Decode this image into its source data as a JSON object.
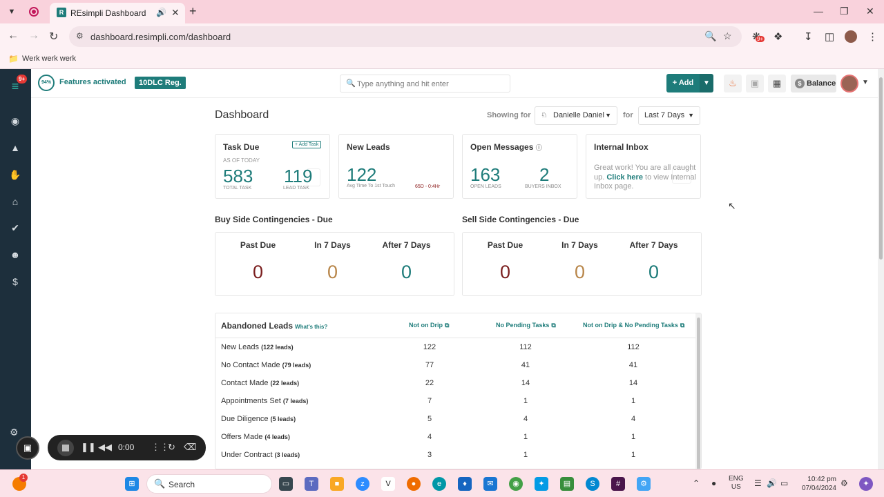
{
  "browser": {
    "tab_title": "REsimpli Dashboard",
    "url": "dashboard.resimpli.com/dashboard",
    "bookmark": "Werk werk werk",
    "ext_badge": "9+"
  },
  "app": {
    "logo_badge": "9+",
    "features_percent": "94%",
    "features_text": "Features activated",
    "dlc_badge": "10DLC Reg.",
    "search_placeholder": "Type anything and hit enter",
    "add_label": "Add",
    "balance_label": "Balance"
  },
  "dashboard": {
    "title": "Dashboard",
    "showing_for_label": "Showing for",
    "user_select": "Danielle Daniel",
    "for_label": "for",
    "period_select": "Last 7 Days"
  },
  "cards": {
    "task_due": {
      "title": "Task Due",
      "add_task": "+ Add Task",
      "as_of": "AS OF TODAY",
      "total_value": "583",
      "total_label": "TOTAL TASK",
      "lead_value": "119",
      "lead_label": "LEAD TASK"
    },
    "new_leads": {
      "title": "New Leads",
      "value": "122",
      "avg_label": "Avg Time To 1st Touch",
      "avg_value": "65D - 0:4Hr"
    },
    "open_messages": {
      "title": "Open Messages",
      "leads_value": "163",
      "leads_label": "OPEN LEADS",
      "buyers_value": "2",
      "buyers_label": "BUYERS INBOX"
    },
    "internal_inbox": {
      "title": "Internal Inbox",
      "text_before": "Great work! You are all caught up.",
      "link": "Click here",
      "text_after": "to view Internal Inbox page."
    }
  },
  "buy_side": {
    "title": "Buy Side Contingencies - Due",
    "cols": [
      {
        "label": "Past Due",
        "value": "0",
        "color": "#7b1f1f"
      },
      {
        "label": "In 7 Days",
        "value": "0",
        "color": "#b8864a"
      },
      {
        "label": "After 7 Days",
        "value": "0",
        "color": "#1e7c7a"
      }
    ]
  },
  "sell_side": {
    "title": "Sell Side Contingencies - Due",
    "cols": [
      {
        "label": "Past Due",
        "value": "0",
        "color": "#7b1f1f"
      },
      {
        "label": "In 7 Days",
        "value": "0",
        "color": "#b8864a"
      },
      {
        "label": "After 7 Days",
        "value": "0",
        "color": "#1e7c7a"
      }
    ]
  },
  "abandoned": {
    "title": "Abandoned Leads",
    "whats": "What's this?",
    "headers": [
      "Not on Drip",
      "No Pending Tasks",
      "Not on Drip & No Pending Tasks"
    ],
    "rows": [
      {
        "label": "New Leads",
        "count": "(122 leads)",
        "vals": [
          "122",
          "112",
          "112"
        ]
      },
      {
        "label": "No Contact Made",
        "count": "(79 leads)",
        "vals": [
          "77",
          "41",
          "41"
        ]
      },
      {
        "label": "Contact Made",
        "count": "(22 leads)",
        "vals": [
          "22",
          "14",
          "14"
        ]
      },
      {
        "label": "Appointments Set",
        "count": "(7 leads)",
        "vals": [
          "7",
          "1",
          "1"
        ]
      },
      {
        "label": "Due Diligence",
        "count": "(5 leads)",
        "vals": [
          "5",
          "4",
          "4"
        ]
      },
      {
        "label": "Offers Made",
        "count": "(4 leads)",
        "vals": [
          "4",
          "1",
          "1"
        ]
      },
      {
        "label": "Under Contract",
        "count": "(3 leads)",
        "vals": [
          "3",
          "1",
          "1"
        ]
      }
    ]
  },
  "recorder": {
    "time": "0:00"
  },
  "taskbar": {
    "search": "Search",
    "lang1": "ENG",
    "lang2": "US",
    "time": "10:42 pm",
    "date": "07/04/2024",
    "notif": "1"
  },
  "colors": {
    "brand": "#1e7c7a",
    "sidebar": "#1d2f3c",
    "chrome": "#f9d2dc"
  }
}
